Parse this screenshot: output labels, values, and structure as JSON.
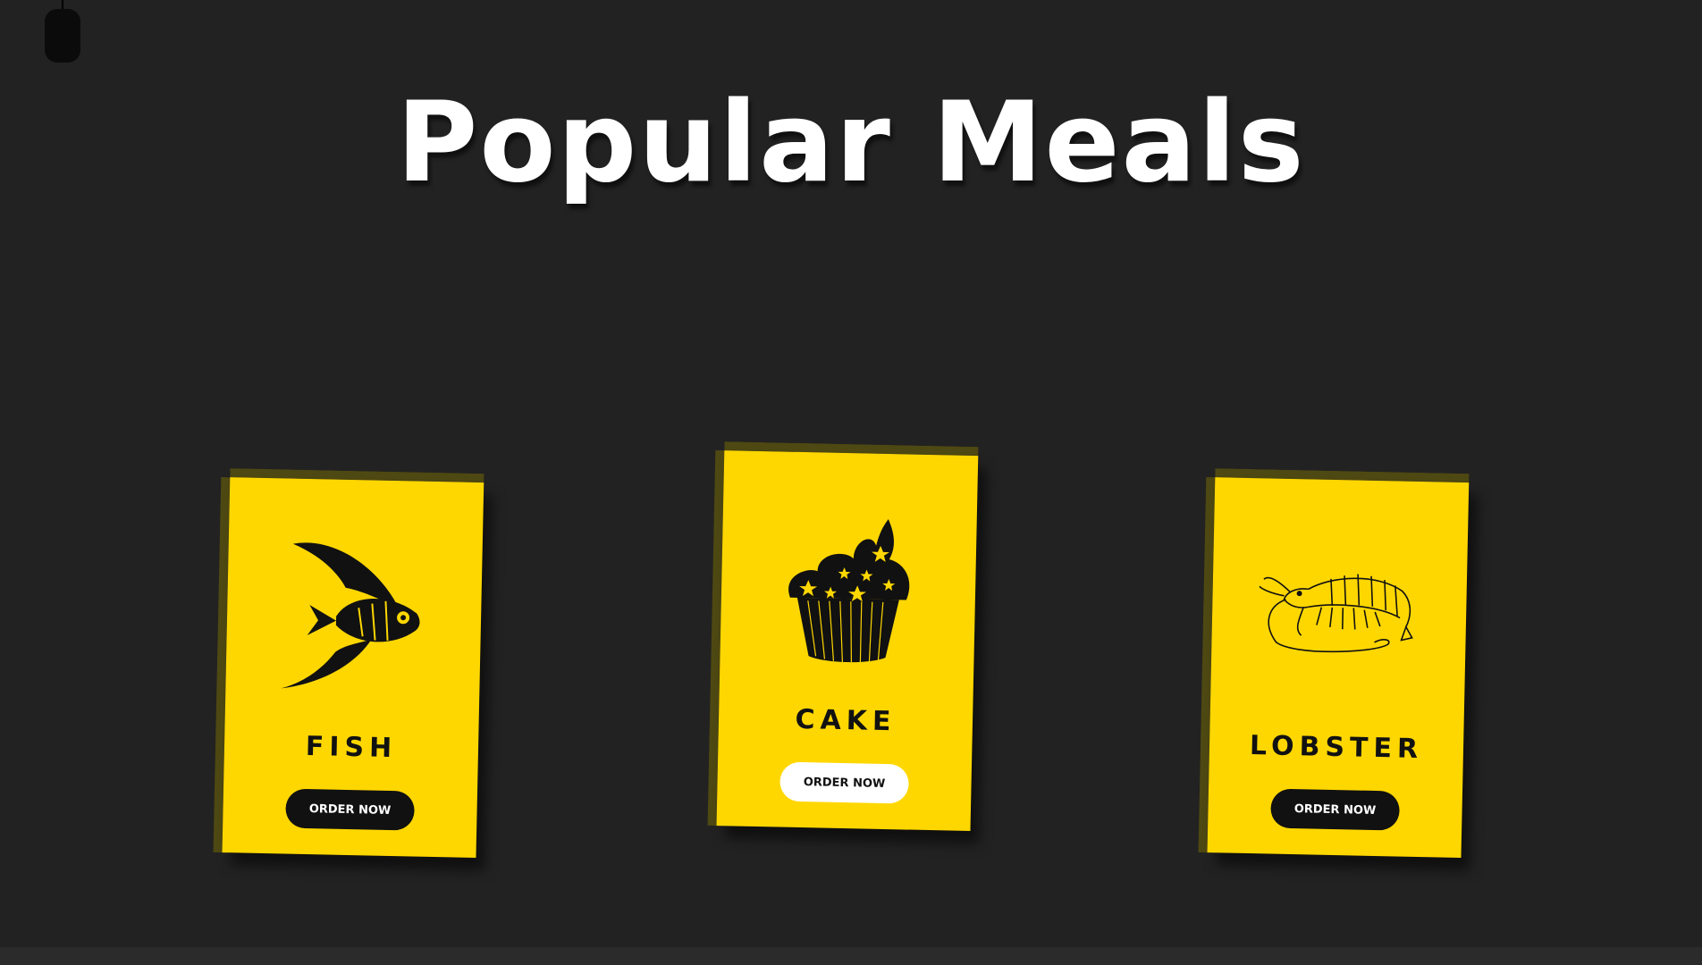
{
  "page": {
    "title": "Popular Meals"
  },
  "colors": {
    "background": "#222222",
    "card": "#ffd700",
    "card_edge": "#4e4812",
    "button_dark": "#111111",
    "button_light": "#ffffff"
  },
  "cards": [
    {
      "name": "FISH",
      "icon": "fish-icon",
      "button_label": "ORDER NOW",
      "button_style": "dark"
    },
    {
      "name": "CAKE",
      "icon": "cupcake-icon",
      "button_label": "ORDER NOW",
      "button_style": "light"
    },
    {
      "name": "LOBSTER",
      "icon": "shrimp-icon",
      "button_label": "ORDER NOW",
      "button_style": "dark"
    }
  ]
}
